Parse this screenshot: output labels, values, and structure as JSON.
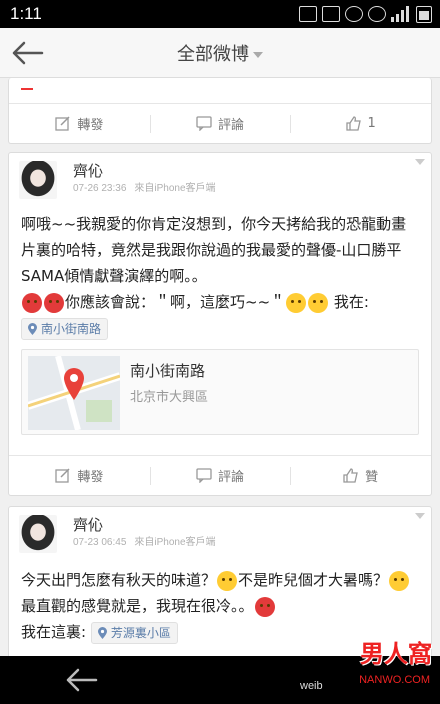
{
  "status": {
    "time": "1:11"
  },
  "header": {
    "title": "全部微博"
  },
  "top_card": {
    "repost": "轉發",
    "comment": "評論",
    "like_count": "1"
  },
  "post1": {
    "name": "齊伈",
    "date": "07-26 23:36",
    "source": "來自iPhone客戶端",
    "text_line1": "啊哦~~我親愛的你肯定沒想到，你今天拷給我的恐龍動畫片裏的哈特，竟然是我跟你說過的我最愛的聲優-山口勝平SAMA傾情獻聲演繹的啊。。",
    "text_quote": "你應該會說：＂啊，這麼巧~~＂",
    "text_me": "我在:",
    "location_tag": "南小街南路",
    "map": {
      "name": "南小街南路",
      "address": "北京市大興區"
    },
    "actions": {
      "repost": "轉發",
      "comment": "評論",
      "like": "贊"
    }
  },
  "post2": {
    "name": "齊伈",
    "date": "07-23 06:45",
    "source": "來自iPhone客戶端",
    "text_a": "今天出門怎麼有秋天的味道？",
    "text_b": "不是昨兒個才大暑嗎？",
    "text_c": "最直觀的感覺就是，我現在很冷。。",
    "text_here": "我在這裏:",
    "location_tag": "芳源裏小區"
  },
  "watermark": {
    "brand": "男人窩",
    "url": "NANWO.COM",
    "weibo": "weib"
  },
  "colors": {
    "link": "#5a7ca8",
    "accent": "#e22222"
  }
}
